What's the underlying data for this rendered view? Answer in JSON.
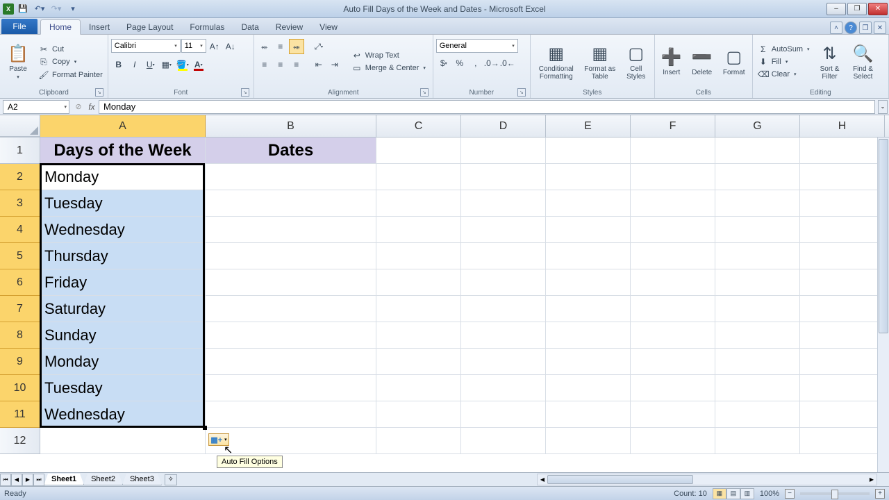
{
  "window": {
    "title": "Auto Fill Days of the Week and Dates - Microsoft Excel"
  },
  "qat": {
    "save": "💾"
  },
  "ribbon": {
    "file": "File",
    "tabs": [
      "Home",
      "Insert",
      "Page Layout",
      "Formulas",
      "Data",
      "Review",
      "View"
    ],
    "active_tab": "Home",
    "clipboard": {
      "paste": "Paste",
      "cut": "Cut",
      "copy": "Copy",
      "format_painter": "Format Painter",
      "label": "Clipboard"
    },
    "font": {
      "name": "Calibri",
      "size": "11",
      "label": "Font"
    },
    "alignment": {
      "wrap": "Wrap Text",
      "merge": "Merge & Center",
      "label": "Alignment"
    },
    "number": {
      "format": "General",
      "label": "Number"
    },
    "styles": {
      "conditional": "Conditional Formatting",
      "format_table": "Format as Table",
      "cell_styles": "Cell Styles",
      "label": "Styles"
    },
    "cells": {
      "insert": "Insert",
      "delete": "Delete",
      "format": "Format",
      "label": "Cells"
    },
    "editing": {
      "autosum": "AutoSum",
      "fill": "Fill",
      "clear": "Clear",
      "sort": "Sort & Filter",
      "find": "Find & Select",
      "label": "Editing"
    }
  },
  "name_box": "A2",
  "formula_bar": "Monday",
  "columns": [
    "A",
    "B",
    "C",
    "D",
    "E",
    "F",
    "G",
    "H"
  ],
  "row_headers": [
    "1",
    "2",
    "3",
    "4",
    "5",
    "6",
    "7",
    "8",
    "9",
    "10",
    "11",
    "12"
  ],
  "header_row": {
    "A": "Days of the Week",
    "B": "Dates"
  },
  "data_col_a": [
    "Monday",
    "Tuesday",
    "Wednesday",
    "Thursday",
    "Friday",
    "Saturday",
    "Sunday",
    "Monday",
    "Tuesday",
    "Wednesday"
  ],
  "autofill": {
    "tooltip": "Auto Fill Options"
  },
  "sheets": [
    "Sheet1",
    "Sheet2",
    "Sheet3"
  ],
  "active_sheet": "Sheet1",
  "status": {
    "ready": "Ready",
    "count_label": "Count:",
    "count": "10",
    "zoom": "100%"
  }
}
